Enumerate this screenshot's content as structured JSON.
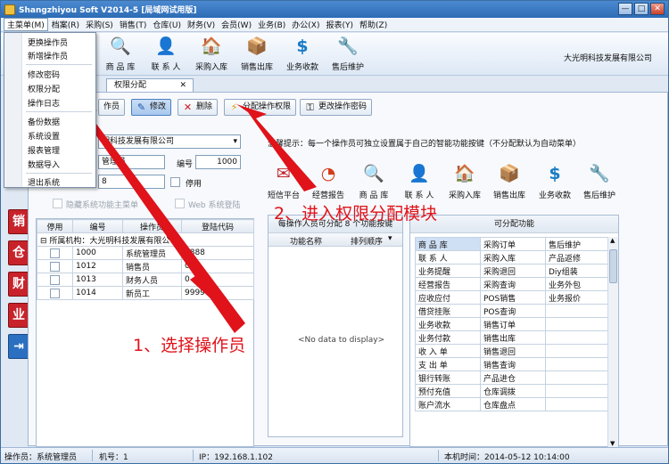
{
  "window": {
    "title": "Shangzhiyou Soft V2014-5 [局域网试用版]",
    "controls": [
      "—",
      "□",
      "✕"
    ]
  },
  "menubar": [
    "主菜单(M)",
    "档案(R)",
    "采购(S)",
    "销售(T)",
    "仓库(U)",
    "财务(V)",
    "会员(W)",
    "业务(B)",
    "办公(X)",
    "报表(Y)",
    "帮助(Z)"
  ],
  "toolbar": {
    "items": [
      {
        "label": "商 品 库",
        "icon": "magnifier-icon",
        "glyph": "🔍"
      },
      {
        "label": "联 系 人",
        "icon": "person-icon",
        "glyph": "👤"
      },
      {
        "label": "采购入库",
        "icon": "house-icon",
        "glyph": "🏠"
      },
      {
        "label": "销售出库",
        "icon": "goods-icon",
        "glyph": "📦"
      },
      {
        "label": "业务收款",
        "icon": "dollar-icon",
        "glyph": "$"
      },
      {
        "label": "售后维护",
        "icon": "tools-icon",
        "glyph": "🔧"
      }
    ],
    "company": "大光明科技发展有限公司"
  },
  "main_menu": [
    "更换操作员",
    "新增操作员",
    "修改密码",
    "权限分配",
    "操作日志",
    "备份数据",
    "系统设置",
    "报表管理",
    "数据导入",
    "退出系统"
  ],
  "side_strip": [
    "销",
    "仓",
    "财",
    "业",
    "⇥"
  ],
  "tab": {
    "label": "权限分配",
    "close": "✕"
  },
  "actions": [
    "作员",
    "修改",
    "删除",
    "分配操作权限",
    "更改操作密码"
  ],
  "form": {
    "org_value": "明科技发展有限公司",
    "name_value": "管理员",
    "no_label": "编号",
    "no_value": "1000",
    "code_value": "8",
    "disable_label": "停用",
    "hide_label": "隐藏系统功能主菜单",
    "web_label": "Web 系统登陆"
  },
  "operators": {
    "headers": [
      "停用",
      "编号",
      "操作员",
      "登陆代码"
    ],
    "group": "所属机构：大光明科技发展有限公司",
    "rows": [
      {
        "no": "1000",
        "name": "系统管理员",
        "code": "8888"
      },
      {
        "no": "1012",
        "name": "销售员",
        "code": "001"
      },
      {
        "no": "1013",
        "name": "财务人员",
        "code": "0"
      },
      {
        "no": "1014",
        "name": "新员工",
        "code": "9999"
      }
    ]
  },
  "hint": "温馨提示：每一个操作员可独立设置属于自己的智能功能按键（不分配默认为自动菜单）",
  "modules": [
    {
      "label": "短信平台",
      "glyph": "✉"
    },
    {
      "label": "经营报告",
      "glyph": "◔"
    },
    {
      "label": "商 品 库",
      "glyph": "🔍"
    },
    {
      "label": "联 系 人",
      "glyph": "👤"
    },
    {
      "label": "采购入库",
      "glyph": "🏠"
    },
    {
      "label": "销售出库",
      "glyph": "📦"
    },
    {
      "label": "业务收款",
      "glyph": "$"
    },
    {
      "label": "售后维护",
      "glyph": "🔧"
    }
  ],
  "assign": {
    "title": "每操作人员可分配 8 个功能按键",
    "col_name": "功能名称",
    "col_order": "排列顺序",
    "no_data": "<No data to display>"
  },
  "available": {
    "title": "可分配功能",
    "rows": [
      [
        "商 品 库",
        "采购订单",
        "售后维护"
      ],
      [
        "联 系 人",
        "采购入库",
        "产品返修"
      ],
      [
        "业务提醒",
        "采购退回",
        "Diy组装"
      ],
      [
        "经营报告",
        "采购查询",
        "业务外包"
      ],
      [
        "应收应付",
        "POS销售",
        "业务报价"
      ],
      [
        "借贷挂账",
        "POS查询",
        ""
      ],
      [
        "业务收款",
        "销售订单",
        ""
      ],
      [
        "业务付款",
        "销售出库",
        ""
      ],
      [
        "收 入 单",
        "销售退回",
        ""
      ],
      [
        "支 出 单",
        "销售查询",
        ""
      ],
      [
        "银行转账",
        "产品进仓",
        ""
      ],
      [
        "预付充值",
        "仓库调拨",
        ""
      ],
      [
        "账户流水",
        "仓库盘点",
        ""
      ]
    ]
  },
  "annotations": {
    "step1": "1、选择操作员",
    "step2": "2、进入权限分配模块"
  },
  "status": {
    "operator": "操作员：系统管理员",
    "machine": "机号：1",
    "ip": "IP：192.168.1.102",
    "time": "本机时间：2014-05-12 10:14:00"
  },
  "colors": {
    "accent_red": "#e0121a",
    "selected_cell": "#cfe0f5",
    "title_blue": "#2d6cb5"
  }
}
